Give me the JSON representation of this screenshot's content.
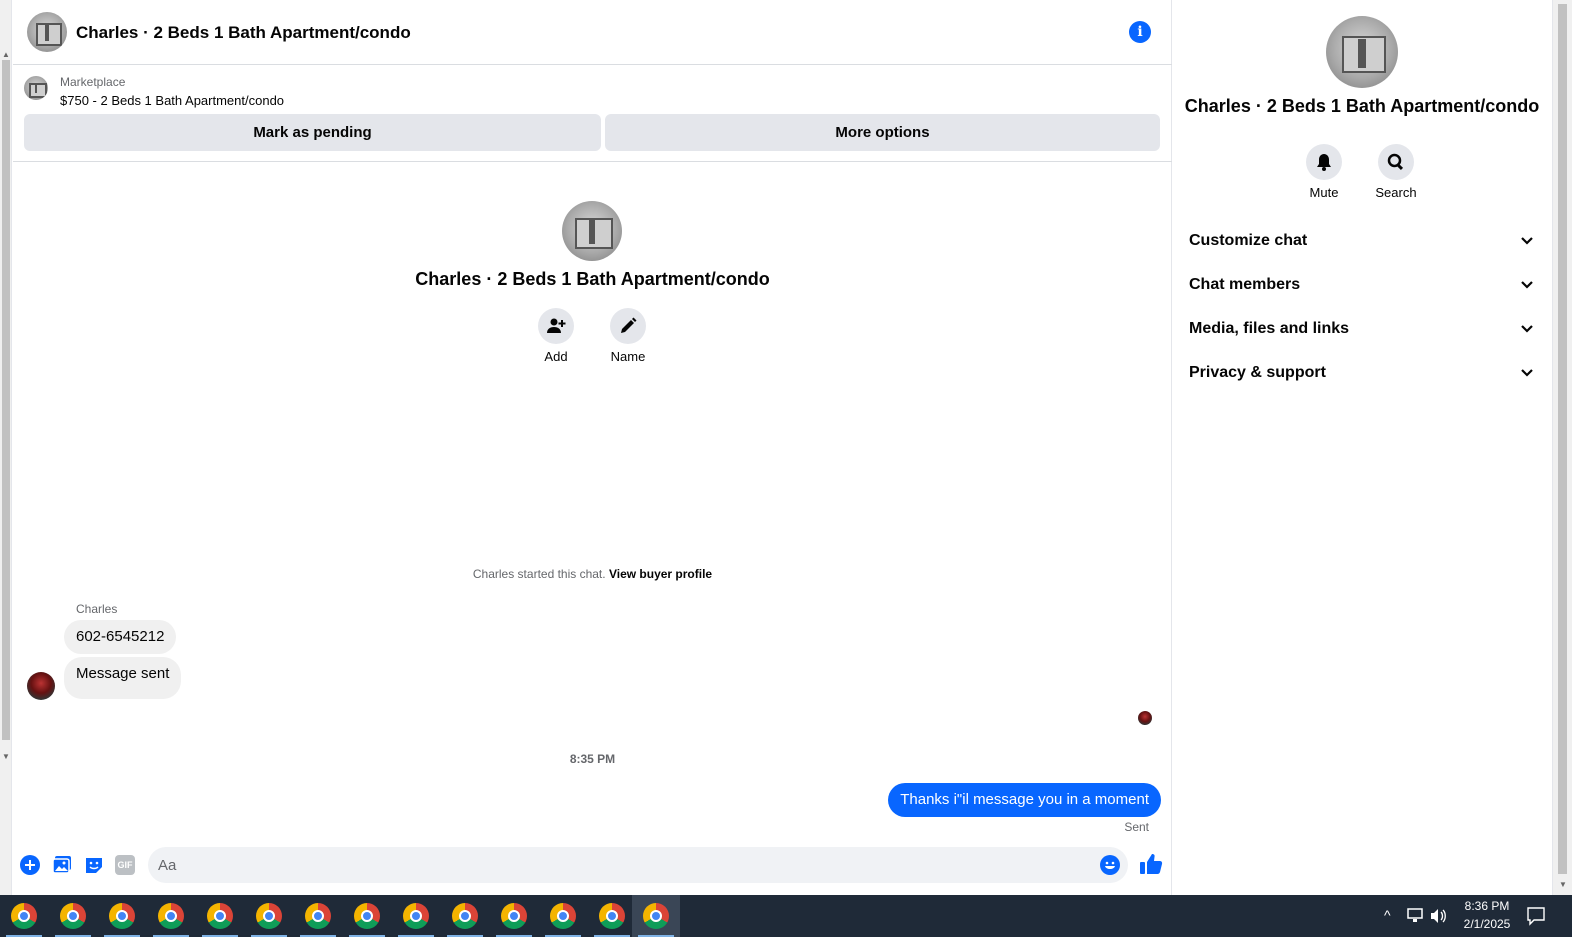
{
  "header": {
    "title": "Charles · 2 Beds 1 Bath Apartment/condo",
    "info_glyph": "i"
  },
  "marketplace": {
    "label": "Marketplace",
    "listing": "$750 - 2 Beds 1 Bath Apartment/condo",
    "mark_pending": "Mark as pending",
    "more_options": "More options"
  },
  "intro": {
    "title": "Charles · 2 Beds 1 Bath Apartment/condo",
    "add_label": "Add",
    "name_label": "Name",
    "started_text": "Charles started this chat.",
    "view_profile": "View buyer profile"
  },
  "messages": {
    "sender": "Charles",
    "in_1": "602-6545212",
    "in_2": "Message sent",
    "time": "8:35 PM",
    "out_1": "Thanks i\"il message you in a moment",
    "status": "Sent"
  },
  "composer": {
    "placeholder": "Aa",
    "gif_label": "GIF"
  },
  "right_panel": {
    "title": "Charles · 2 Beds 1 Bath Apartment/condo",
    "mute_label": "Mute",
    "search_label": "Search",
    "sections": [
      "Customize chat",
      "Chat members",
      "Media, files and links",
      "Privacy & support"
    ]
  },
  "taskbar": {
    "time": "8:36 PM",
    "date": "2/1/2025"
  },
  "colors": {
    "accent": "#0866ff",
    "bubble_in": "#f0f0f0",
    "button_gray": "#e4e6eb",
    "taskbar": "#1f2a38"
  }
}
